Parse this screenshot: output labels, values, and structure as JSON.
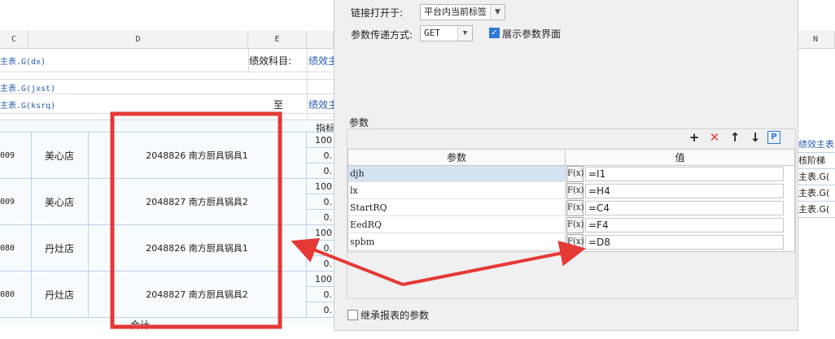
{
  "sheet": {
    "columns": [
      "C",
      "D",
      "E",
      "N"
    ],
    "rows": [
      {
        "c": "主表.G(dx)",
        "e": "绩效科目:",
        "f": "绩效主"
      },
      {
        "c": "主表.G(jxst)"
      },
      {
        "c": "主表.G(ksrq)",
        "e": "至",
        "f": "绩效主"
      }
    ],
    "header_fragment": "指标",
    "footer_fragment": "合计"
  },
  "fragment_rows": [
    {
      "code": "009",
      "store": "美心店",
      "product": "2048826  南方厨具锅具1",
      "subs": [
        "100",
        "0.",
        "0."
      ]
    },
    {
      "code": "009",
      "store": "美心店",
      "product": "2048827  南方厨具锅具2",
      "subs": [
        "100",
        "0.",
        "0."
      ]
    },
    {
      "code": "080",
      "store": "丹灶店",
      "product": "2048826  南方厨具锅具1",
      "subs": [
        "100",
        "0.",
        "0."
      ]
    },
    {
      "code": "080",
      "store": "丹灶店",
      "product": "2048827  南方厨具锅具2",
      "subs": [
        "100",
        "0.",
        "0."
      ]
    }
  ],
  "right_cells": [
    "绩效主表",
    "核阶梯",
    "主表.G(",
    "主表.G(",
    "主表.G("
  ],
  "dialog": {
    "link_open_label": "链接打开于:",
    "link_open_value": "平台内当前标签",
    "param_method_label": "参数传递方式:",
    "param_method_value": "GET",
    "show_param_label": "展示参数界面",
    "params_group_label": "参数",
    "table_headers": {
      "name": "参数",
      "value": "值"
    },
    "fx_label": "F(x)",
    "params": [
      {
        "name": "djh",
        "value": "=I1"
      },
      {
        "name": "lx",
        "value": "=H4"
      },
      {
        "name": "StartRQ",
        "value": "=C4"
      },
      {
        "name": "EedRQ",
        "value": "=F4"
      },
      {
        "name": "spbm",
        "value": "=D8"
      }
    ],
    "inherit_label": "继承报表的参数",
    "toolbar": {
      "add": "+",
      "delete": "✕",
      "up": "↑",
      "down": "↓",
      "p": "P"
    }
  },
  "colors": {
    "annotation_red": "#e53935",
    "link_blue": "#2a5db0",
    "accent": "#2f7ad8"
  }
}
